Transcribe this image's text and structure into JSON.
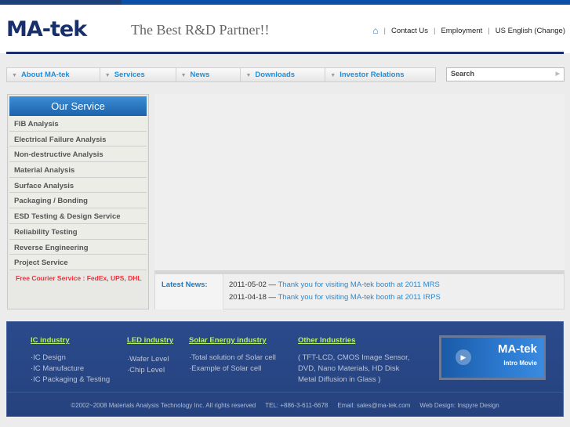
{
  "header": {
    "logo": "MA-tek",
    "tagline": "The Best R&D Partner!!",
    "links": [
      "Contact Us",
      "Employment",
      "US English (Change)"
    ]
  },
  "nav": {
    "items": [
      "About MA-tek",
      "Services",
      "News",
      "Downloads",
      "Investor Relations"
    ],
    "search_placeholder": "Search"
  },
  "sidebar": {
    "title": "Our Service",
    "items": [
      "FIB Analysis",
      "Electrical Failure Analysis",
      "Non-destructive Analysis",
      "Material Analysis",
      "Surface Analysis",
      "Packaging / Bonding",
      "ESD Testing & Design Service",
      "Reliability Testing",
      "Reverse Engineering",
      "Project Service"
    ],
    "courier": "Free Courier Service : FedEx, UPS, DHL"
  },
  "news": {
    "label": "Latest News:",
    "items": [
      {
        "date": "2011-05-02 —",
        "title": "Thank you for visiting MA-tek booth at 2011 MRS"
      },
      {
        "date": "2011-04-18 —",
        "title": "Thank you for visiting MA-tek booth at 2011 IRPS"
      }
    ]
  },
  "footer": {
    "columns": [
      {
        "title": "IC industry",
        "items": [
          "·IC Design",
          "·IC Manufacture",
          "·IC Packaging & Testing"
        ]
      },
      {
        "title": "LED industry",
        "items": [
          "·Wafer Level",
          "·Chip Level"
        ]
      },
      {
        "title": "Solar Energy industry",
        "items": [
          "·Total solution of Solar cell",
          "·Example of Solar cell"
        ]
      },
      {
        "title": "Other Industries",
        "items": [
          "( TFT-LCD, CMOS Image Sensor,",
          "DVD, Nano Materials, HD Disk",
          "Metal Diffusion in Glass )"
        ]
      }
    ],
    "movie": {
      "title": "MA-tek",
      "subtitle": "Intro Movie"
    },
    "copyright": "©2002~2008 Materials Analysis Technology Inc. All rights reserved",
    "tel": "TEL: +886-3-611-6678",
    "email": "Email: sales@ma-tek.com",
    "design": "Web Design: Inspyre Design"
  }
}
